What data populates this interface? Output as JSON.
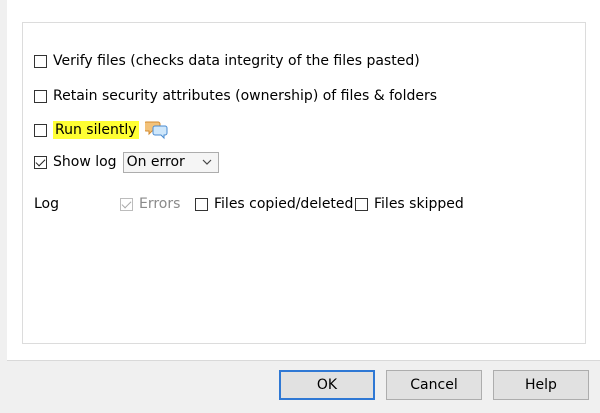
{
  "options": {
    "verify_files": {
      "label": "Verify files (checks data integrity of the files pasted)",
      "checked": false
    },
    "retain_security": {
      "label": "Retain security attributes (ownership) of files & folders",
      "checked": false
    },
    "run_silently": {
      "label": "Run silently",
      "checked": false,
      "highlight_color": "#ffff33"
    },
    "show_log": {
      "label": "Show log",
      "checked": true,
      "selected": "On error"
    }
  },
  "log": {
    "label": "Log",
    "errors": {
      "label": "Errors",
      "checked": true,
      "enabled": false
    },
    "files_copied": {
      "label": "Files copied/deleted",
      "checked": false
    },
    "files_skipped": {
      "label": "Files skipped",
      "checked": false
    }
  },
  "buttons": {
    "ok": "OK",
    "cancel": "Cancel",
    "help": "Help"
  },
  "icons": {
    "chat": "chat-bubbles-icon",
    "chevron": "chevron-down-icon"
  },
  "colors": {
    "accent": "#2f78d4",
    "highlight": "#ffff33"
  }
}
